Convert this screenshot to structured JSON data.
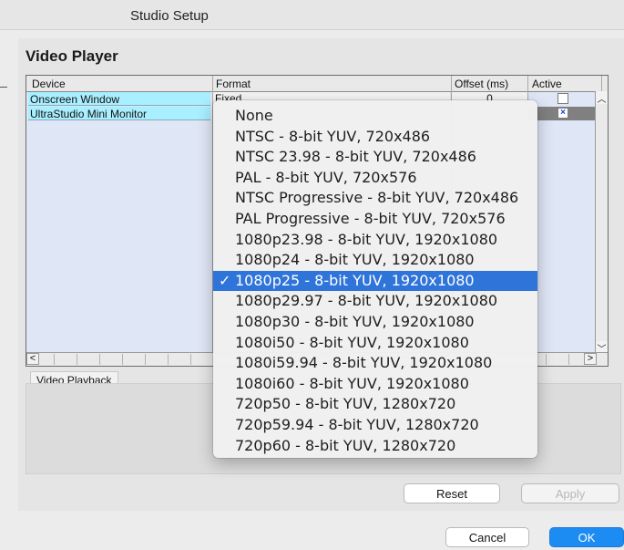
{
  "window": {
    "title": "Studio Setup"
  },
  "section": {
    "title": "Video Player"
  },
  "table": {
    "headers": [
      "Device",
      "Format",
      "Offset (ms)",
      "Active"
    ],
    "rows": [
      {
        "device": "Onscreen Window",
        "format": "Fixed",
        "offset": "0",
        "active": false
      },
      {
        "device": "UltraStudio Mini Monitor",
        "format": "",
        "offset": "",
        "active": true
      }
    ]
  },
  "group": {
    "label": "Video Playback"
  },
  "buttons": {
    "reset": "Reset",
    "apply": "Apply",
    "cancel": "Cancel",
    "ok": "OK"
  },
  "dropdown": {
    "selected_index": 8,
    "check_glyph": "✓",
    "options": [
      "None",
      "NTSC - 8-bit YUV, 720x486",
      "NTSC 23.98 - 8-bit YUV, 720x486",
      "PAL - 8-bit YUV, 720x576",
      "NTSC Progressive - 8-bit YUV, 720x486",
      "PAL Progressive - 8-bit YUV, 720x576",
      "1080p23.98 - 8-bit YUV, 1920x1080",
      "1080p24 - 8-bit YUV, 1920x1080",
      "1080p25 - 8-bit YUV, 1920x1080",
      "1080p29.97 - 8-bit YUV, 1920x1080",
      "1080p30 - 8-bit YUV, 1920x1080",
      "1080i50 - 8-bit YUV, 1920x1080",
      "1080i59.94 - 8-bit YUV, 1920x1080",
      "1080i60 - 8-bit YUV, 1920x1080",
      "720p50 - 8-bit YUV, 1280x720",
      "720p59.94 - 8-bit YUV, 1280x720",
      "720p60 - 8-bit YUV, 1280x720"
    ]
  },
  "icons": {
    "scroll_up": "chevron-up-icon",
    "scroll_down": "chevron-down-icon",
    "scroll_left": "chevron-left-icon",
    "scroll_right": "chevron-right-icon",
    "check": "checkmark-icon"
  },
  "colors": {
    "accent": "#2f74d9",
    "device_cell": "#a8efff",
    "active_check": "#1f3fd0",
    "ok_button": "#1c8cf3"
  }
}
